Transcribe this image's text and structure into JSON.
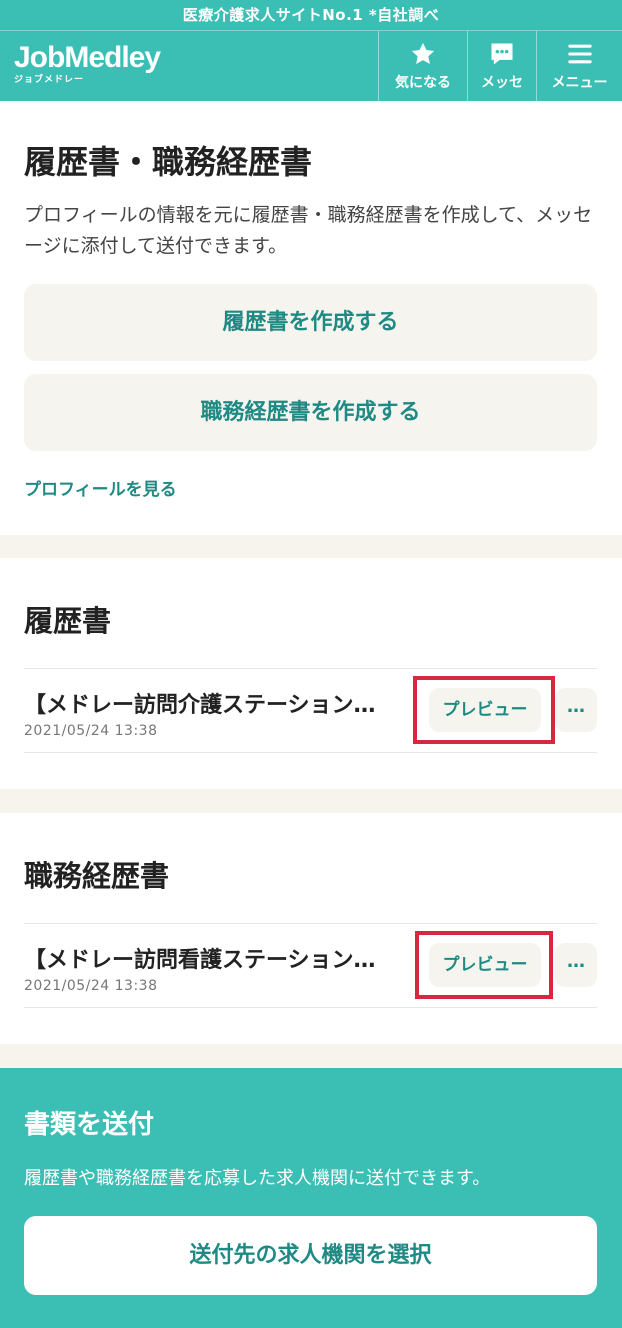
{
  "banner": {
    "text": "医療介護求人サイトNo.1 *自社調べ"
  },
  "header": {
    "logo_main": "JobMedley",
    "logo_sub": "ジョブメドレー",
    "buttons": [
      {
        "label": "気になる",
        "icon": "star-icon"
      },
      {
        "label": "メッセ",
        "icon": "chat-bubble-icon"
      },
      {
        "label": "メニュー",
        "icon": "hamburger-menu-icon"
      }
    ]
  },
  "intro": {
    "title": "履歴書・職務経歴書",
    "description": "プロフィールの情報を元に履歴書・職務経歴書を作成して、メッセージに添付して送付できます。",
    "create_resume_label": "履歴書を作成する",
    "create_career_label": "職務経歴書を作成する",
    "profile_link": "プロフィールを見る"
  },
  "resume_section": {
    "heading": "履歴書",
    "items": [
      {
        "title": "【メドレー訪問介護ステーション…",
        "date": "2021/05/24 13:38",
        "preview_label": "プレビュー",
        "more_label": "…"
      }
    ]
  },
  "career_section": {
    "heading": "職務経歴書",
    "items": [
      {
        "title": "【メドレー訪問看護ステーション…",
        "date": "2021/05/24 13:38",
        "preview_label": "プレビュー",
        "more_label": "…"
      }
    ]
  },
  "send_section": {
    "title": "書類を送付",
    "description": "履歴書や職務経歴書を応募した求人機関に送付できます。",
    "button_label": "送付先の求人機関を選択"
  },
  "colors": {
    "brand": "#3bbfb4",
    "accent_text": "#1f8a84",
    "highlight": "#d8283f",
    "button_bg": "#f6f4ee"
  }
}
